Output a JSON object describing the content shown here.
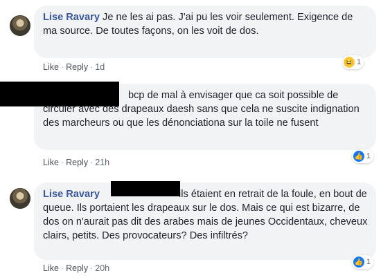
{
  "comments": [
    {
      "author": "Lise Ravary",
      "text": "Je ne les ai pas. J'ai pu les voir seulement. Exigence de ma source. De toutes façons, on les voit de dos.",
      "like": "Like",
      "reply": "Reply",
      "time": "1d",
      "reaction_icon": "haha-icon",
      "reaction_count": "1"
    },
    {
      "author": "",
      "text": "bcp de mal à envisager que ca soit possible de circuler avec des drapeaux daesh sans que cela ne suscite indignation des marcheurs ou que les dénonciationa sur la toile ne fusent",
      "like": "Like",
      "reply": "Reply",
      "time": "21h",
      "reaction_icon": "like-icon",
      "reaction_count": "1"
    },
    {
      "author": "Lise Ravary",
      "text": "ils étaient en retrait de la foule, en bout de queue. Ils portaient les drapeaux sur le dos. Mais ce qui est bizarre, de dos on n'aurait pas dit des arabes mais de jeunes Occidentaux, cheveux clairs, petits. Des provocateurs? Des infiltrés?",
      "like": "Like",
      "reply": "Reply",
      "time": "20h",
      "reaction_icon": "like-icon",
      "reaction_count": "1"
    }
  ],
  "separator": "·"
}
